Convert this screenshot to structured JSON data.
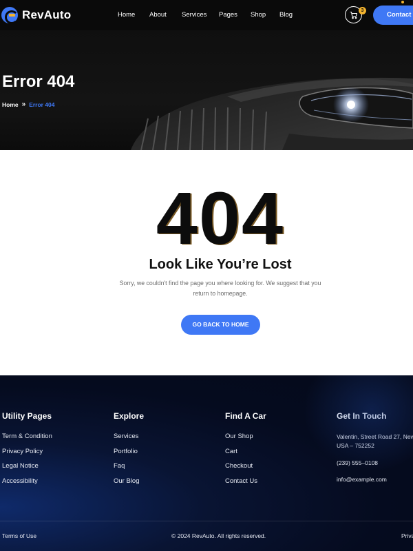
{
  "brand": {
    "name": "RevAuto"
  },
  "nav": {
    "items": [
      {
        "label": "Home"
      },
      {
        "label": "About"
      },
      {
        "label": "Services"
      },
      {
        "label": "Pages"
      },
      {
        "label": "Shop"
      },
      {
        "label": "Blog"
      }
    ],
    "cart_count": "3",
    "cta_label": "Contact Us"
  },
  "hero": {
    "title": "Error 404",
    "breadcrumb": {
      "home": "Home",
      "current": "Error 404"
    }
  },
  "error": {
    "code": "404",
    "title": "Look Like You’re Lost",
    "message": "Sorry, we couldn't find the page you where looking for. We suggest that you return to homepage.",
    "button_label": "GO BACK TO HOME"
  },
  "footer": {
    "utility": {
      "title": "Utility Pages",
      "links": [
        "Term & Condition",
        "Privacy Policy",
        "Legal Notice",
        "Accessibility"
      ]
    },
    "explore": {
      "title": "Explore",
      "links": [
        "Services",
        "Portfolio",
        "Faq",
        "Our Blog"
      ]
    },
    "find_car": {
      "title": "Find A Car",
      "links": [
        "Our Shop",
        "Cart",
        "Checkout",
        "Contact Us"
      ]
    },
    "contact": {
      "title": "Get In Touch",
      "address_line1": "Valentin, Street Road 27, New",
      "address_line2": "USA – 752252",
      "phone": "(239) 555–0108",
      "email": "info@example.com"
    },
    "bottom": {
      "terms": "Terms of Use",
      "copyright": "© 2024 RevAuto. All rights reserved.",
      "privacy": "Privacy"
    }
  },
  "colors": {
    "accent": "#3f78f5",
    "badge": "#f3b32e",
    "header_bg": "#0a0a0a",
    "footer_bg": "#050b1f"
  }
}
